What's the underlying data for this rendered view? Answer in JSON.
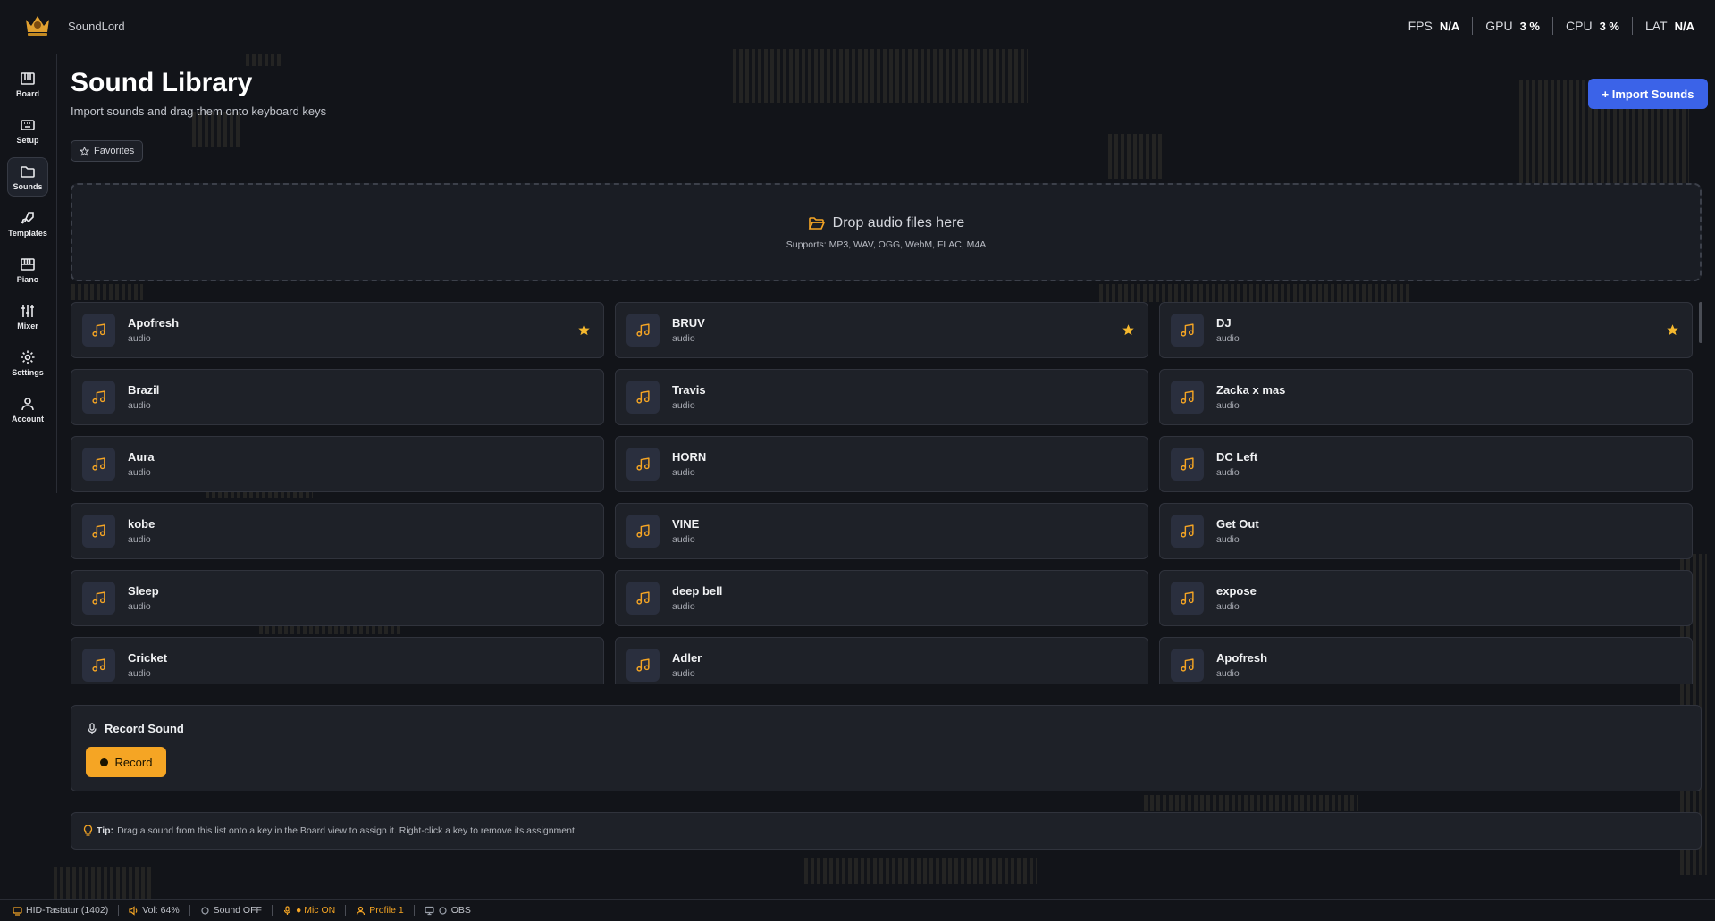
{
  "app": {
    "name": "SoundLord"
  },
  "stats": [
    {
      "label": "FPS",
      "value": "N/A"
    },
    {
      "label": "GPU",
      "value": "3 %"
    },
    {
      "label": "CPU",
      "value": "3 %"
    },
    {
      "label": "LAT",
      "value": "N/A"
    }
  ],
  "sidebar": {
    "items": [
      {
        "label": "Board",
        "icon": "piano-keys-icon"
      },
      {
        "label": "Setup",
        "icon": "keyboard-icon"
      },
      {
        "label": "Sounds",
        "icon": "folder-icon",
        "active": true
      },
      {
        "label": "Templates",
        "icon": "rocket-icon"
      },
      {
        "label": "Piano",
        "icon": "piano-icon"
      },
      {
        "label": "Mixer",
        "icon": "sliders-icon"
      },
      {
        "label": "Settings",
        "icon": "gear-icon"
      },
      {
        "label": "Account",
        "icon": "user-icon"
      }
    ]
  },
  "page": {
    "title": "Sound Library",
    "subtitle": "Import sounds and drag them onto keyboard keys",
    "import_label": "+ Import Sounds",
    "favorites_label": "Favorites"
  },
  "dropzone": {
    "title": "Drop audio files here",
    "supports": "Supports: MP3, WAV, OGG, WebM, FLAC, M4A"
  },
  "sounds": [
    {
      "name": "Apofresh",
      "type": "audio",
      "favorite": true
    },
    {
      "name": "BRUV",
      "type": "audio",
      "favorite": true
    },
    {
      "name": "DJ",
      "type": "audio",
      "favorite": true
    },
    {
      "name": "Brazil",
      "type": "audio",
      "favorite": false
    },
    {
      "name": "Travis",
      "type": "audio",
      "favorite": false
    },
    {
      "name": "Zacka x mas",
      "type": "audio",
      "favorite": false
    },
    {
      "name": "Aura",
      "type": "audio",
      "favorite": false
    },
    {
      "name": "HORN",
      "type": "audio",
      "favorite": false
    },
    {
      "name": "DC Left",
      "type": "audio",
      "favorite": false
    },
    {
      "name": "kobe",
      "type": "audio",
      "favorite": false
    },
    {
      "name": "VINE",
      "type": "audio",
      "favorite": false
    },
    {
      "name": "Get Out",
      "type": "audio",
      "favorite": false
    },
    {
      "name": "Sleep",
      "type": "audio",
      "favorite": false
    },
    {
      "name": "deep bell",
      "type": "audio",
      "favorite": false
    },
    {
      "name": "expose",
      "type": "audio",
      "favorite": false
    },
    {
      "name": "Cricket",
      "type": "audio",
      "favorite": false
    },
    {
      "name": "Adler",
      "type": "audio",
      "favorite": false
    },
    {
      "name": "Apofresh",
      "type": "audio",
      "favorite": false
    }
  ],
  "record": {
    "title": "Record Sound",
    "button_label": "Record"
  },
  "tip": {
    "label": "Tip:",
    "text": "Drag a sound from this list onto a key in the Board view to assign it. Right-click a key to remove its assignment."
  },
  "status_bar": {
    "device": "HID-Tastatur (1402)",
    "volume": "Vol: 64%",
    "sound": "Sound OFF",
    "mic": "● Mic ON",
    "profile": "Profile 1",
    "obs": "OBS"
  },
  "colors": {
    "accent": "#f5a524",
    "primary": "#3b63e8",
    "background": "#121419",
    "card": "#1e2128"
  }
}
